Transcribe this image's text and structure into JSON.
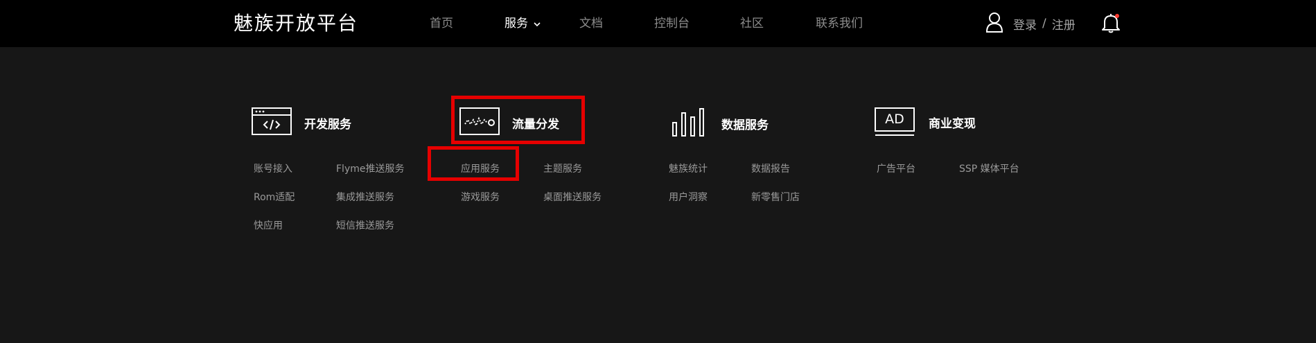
{
  "header": {
    "brand": "魅族开放平台",
    "nav": [
      "首页",
      "服务",
      "文档",
      "控制台",
      "社区",
      "联系我们"
    ],
    "active_nav": "服务",
    "login": "登录",
    "separator": "/",
    "register": "注册"
  },
  "categories": [
    {
      "title": "开发服务",
      "icon": "code-window-icon",
      "links": [
        "账号接入",
        "Flyme推送服务",
        "Rom适配",
        "集成推送服务",
        "快应用",
        "短信推送服务"
      ]
    },
    {
      "title": "流量分发",
      "icon": "traffic-wave-icon",
      "links": [
        "应用服务",
        "主题服务",
        "游戏服务",
        "桌面推送服务"
      ]
    },
    {
      "title": "数据服务",
      "icon": "bar-chart-icon",
      "links": [
        "魅族统计",
        "数据报告",
        "用户洞察",
        "新零售门店"
      ]
    },
    {
      "title": "商业变现",
      "icon": "ad-icon",
      "icon_text": "AD",
      "links": [
        "广告平台",
        "SSP 媒体平台"
      ]
    }
  ],
  "colors": {
    "background": "#171717",
    "header": "#000000",
    "highlight": "#e60000",
    "notification_dot": "#ff3b30"
  }
}
